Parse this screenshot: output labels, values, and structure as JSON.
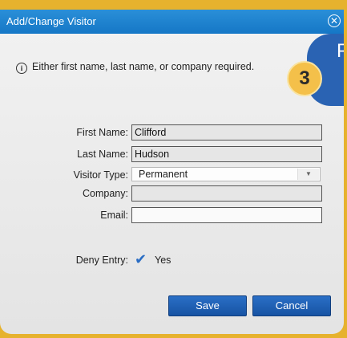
{
  "dialog": {
    "title": "Add/Change Visitor",
    "close_icon": "circle-x-icon"
  },
  "info": {
    "icon": "info-icon",
    "icon_glyph": "i",
    "message": "Either first name, last name, or company required."
  },
  "step": {
    "number": "3",
    "panel_letter": "P"
  },
  "form": {
    "first_name": {
      "label": "First Name:",
      "value": "Clifford"
    },
    "last_name": {
      "label": "Last Name:",
      "value": "Hudson"
    },
    "visitor_type": {
      "label": "Visitor Type:",
      "value": "Permanent"
    },
    "company": {
      "label": "Company:",
      "value": ""
    },
    "email": {
      "label": "Email:",
      "value": ""
    },
    "deny_entry": {
      "label": "Deny Entry:",
      "checked": true,
      "text": "Yes"
    }
  },
  "buttons": {
    "save": "Save",
    "cancel": "Cancel"
  },
  "colors": {
    "titlebar": "#1f84d0",
    "button": "#1f5fb4",
    "frame": "#e6b22e",
    "badge": "#f4c04a",
    "step_panel": "#2a63b3"
  }
}
